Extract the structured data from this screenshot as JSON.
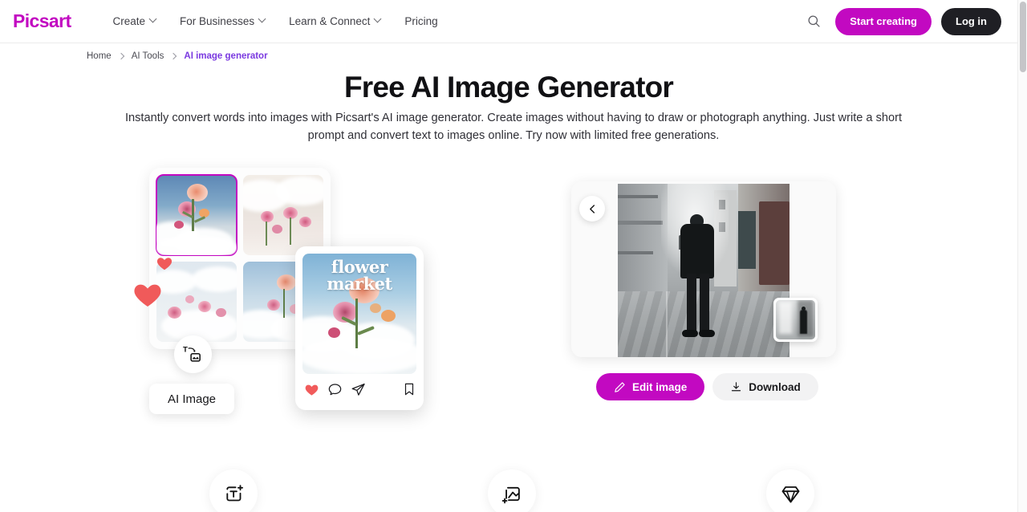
{
  "header": {
    "logo": "Picsart",
    "nav": [
      {
        "label": "Create",
        "has_caret": true
      },
      {
        "label": "For Businesses",
        "has_caret": true
      },
      {
        "label": "Learn & Connect",
        "has_caret": true
      },
      {
        "label": "Pricing",
        "has_caret": false
      }
    ],
    "search_icon": "search-icon",
    "start_creating_label": "Start creating",
    "login_label": "Log in",
    "brand_color": "#C209C1",
    "login_bg": "#1f1f24"
  },
  "breadcrumb": {
    "items": [
      {
        "label": "Home",
        "active": false
      },
      {
        "label": "AI Tools",
        "active": false
      },
      {
        "label": "AI image generator",
        "active": true
      }
    ],
    "active_color": "#7A39E0"
  },
  "page": {
    "title": "Free AI Image Generator",
    "subtitle": "Instantly convert words into images with Picsart's AI image generator. Create images without having to draw or photograph anything. Just write a short prompt and convert text to images online. Try now with limited free generations."
  },
  "left_art": {
    "ai_badge_icon": "text-to-image-icon",
    "ai_label": "AI Image",
    "selected_thumb_index": 0,
    "selection_color": "#C209C1",
    "post_card": {
      "caption_line1": "flower",
      "caption_line2": "market",
      "actions": [
        "heart-icon",
        "comment-icon",
        "share-icon",
        "bookmark-icon"
      ],
      "heart_color": "#F15B5B"
    }
  },
  "right_art": {
    "prev_button_icon": "chevron-left-icon",
    "thumbnail_count": 1,
    "buttons": [
      {
        "label": "Edit image",
        "icon": "pencil-icon",
        "style": "primary"
      },
      {
        "label": "Download",
        "icon": "download-icon",
        "style": "secondary"
      }
    ]
  },
  "features": [
    {
      "icon": "add-text-icon",
      "name": "add-text"
    },
    {
      "icon": "add-image-icon",
      "name": "add-image"
    },
    {
      "icon": "diamond-icon",
      "name": "premium"
    }
  ]
}
